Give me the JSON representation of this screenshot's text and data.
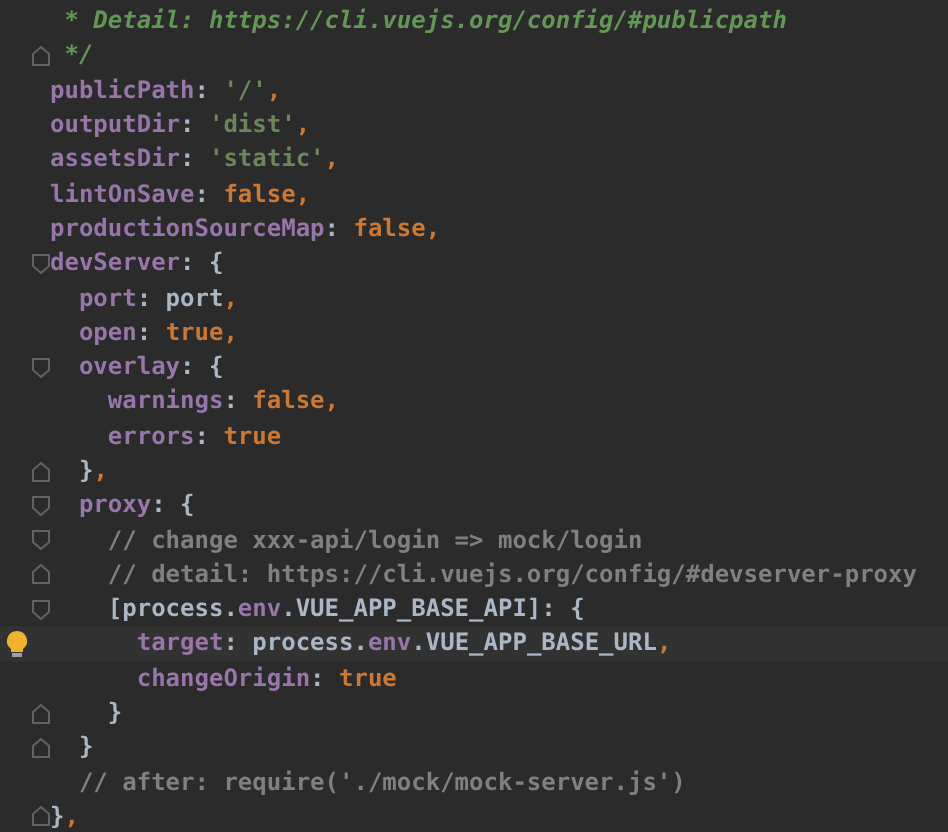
{
  "editor": {
    "lines": [
      {
        "kind": "line",
        "tokens": [
          {
            "t": " * Detail: https://cli.vuejs.org/config/#publicpath",
            "kind": "doc"
          }
        ]
      },
      {
        "kind": "end",
        "tokens": [
          {
            "t": " */",
            "kind": "doc"
          }
        ]
      },
      {
        "kind": "line",
        "tokens": [
          {
            "t": "publicPath",
            "kind": "key"
          },
          {
            "t": ": ",
            "kind": "plain"
          },
          {
            "t": "'/'",
            "kind": "string"
          },
          {
            "t": ",",
            "kind": "punct"
          }
        ]
      },
      {
        "kind": "line",
        "tokens": [
          {
            "t": "outputDir",
            "kind": "key"
          },
          {
            "t": ": ",
            "kind": "plain"
          },
          {
            "t": "'dist'",
            "kind": "string"
          },
          {
            "t": ",",
            "kind": "punct"
          }
        ]
      },
      {
        "kind": "line",
        "tokens": [
          {
            "t": "assetsDir",
            "kind": "key"
          },
          {
            "t": ": ",
            "kind": "plain"
          },
          {
            "t": "'static'",
            "kind": "string"
          },
          {
            "t": ",",
            "kind": "punct"
          }
        ]
      },
      {
        "kind": "line",
        "tokens": [
          {
            "t": "lintOnSave",
            "kind": "key"
          },
          {
            "t": ": ",
            "kind": "plain"
          },
          {
            "t": "false",
            "kind": "keyword"
          },
          {
            "t": ",",
            "kind": "punct"
          }
        ]
      },
      {
        "kind": "line",
        "tokens": [
          {
            "t": "productionSourceMap",
            "kind": "key"
          },
          {
            "t": ": ",
            "kind": "plain"
          },
          {
            "t": "false",
            "kind": "keyword"
          },
          {
            "t": ",",
            "kind": "punct"
          }
        ]
      },
      {
        "kind": "start",
        "tokens": [
          {
            "t": "devServer",
            "kind": "key"
          },
          {
            "t": ": {",
            "kind": "plain"
          }
        ]
      },
      {
        "kind": "line",
        "tokens": [
          {
            "t": "  port",
            "kind": "key"
          },
          {
            "t": ": port",
            "kind": "plain"
          },
          {
            "t": ",",
            "kind": "punct"
          }
        ]
      },
      {
        "kind": "line",
        "tokens": [
          {
            "t": "  open",
            "kind": "key"
          },
          {
            "t": ": ",
            "kind": "plain"
          },
          {
            "t": "true",
            "kind": "keyword"
          },
          {
            "t": ",",
            "kind": "punct"
          }
        ]
      },
      {
        "kind": "start",
        "tokens": [
          {
            "t": "  overlay",
            "kind": "key"
          },
          {
            "t": ": {",
            "kind": "plain"
          }
        ]
      },
      {
        "kind": "line",
        "tokens": [
          {
            "t": "    warnings",
            "kind": "key"
          },
          {
            "t": ": ",
            "kind": "plain"
          },
          {
            "t": "false",
            "kind": "keyword"
          },
          {
            "t": ",",
            "kind": "punct"
          }
        ]
      },
      {
        "kind": "line",
        "tokens": [
          {
            "t": "    errors",
            "kind": "key"
          },
          {
            "t": ": ",
            "kind": "plain"
          },
          {
            "t": "true",
            "kind": "keyword"
          }
        ]
      },
      {
        "kind": "end",
        "tokens": [
          {
            "t": "  }",
            "kind": "plain"
          },
          {
            "t": ",",
            "kind": "punct"
          }
        ]
      },
      {
        "kind": "start",
        "tokens": [
          {
            "t": "  proxy",
            "kind": "key"
          },
          {
            "t": ": {",
            "kind": "plain"
          }
        ]
      },
      {
        "kind": "start",
        "tokens": [
          {
            "t": "    // change xxx-api/login => mock/login",
            "kind": "comment"
          }
        ]
      },
      {
        "kind": "end",
        "tokens": [
          {
            "t": "    // detail: https://cli.vuejs.org/config/#devserver-proxy",
            "kind": "comment"
          }
        ]
      },
      {
        "kind": "start",
        "tokens": [
          {
            "t": "    [process.",
            "kind": "plain"
          },
          {
            "t": "env",
            "kind": "key"
          },
          {
            "t": ".VUE_APP_BASE_API]: {",
            "kind": "plain"
          }
        ]
      },
      {
        "kind": "line",
        "current": true,
        "hint": true,
        "tokens": [
          {
            "t": "      target",
            "kind": "key"
          },
          {
            "t": ": process.",
            "kind": "plain"
          },
          {
            "t": "env",
            "kind": "key"
          },
          {
            "t": ".VUE_APP_BASE_URL",
            "kind": "plain"
          },
          {
            "t": ",",
            "kind": "punct"
          }
        ]
      },
      {
        "kind": "line",
        "tokens": [
          {
            "t": "      changeOrigin",
            "kind": "key"
          },
          {
            "t": ": ",
            "kind": "plain"
          },
          {
            "t": "true",
            "kind": "keyword"
          }
        ]
      },
      {
        "kind": "end",
        "tokens": [
          {
            "t": "    }",
            "kind": "plain"
          }
        ]
      },
      {
        "kind": "end",
        "tokens": [
          {
            "t": "  }",
            "kind": "plain"
          }
        ]
      },
      {
        "kind": "line",
        "tokens": [
          {
            "t": "  // after: require('./mock/mock-server.js')",
            "kind": "comment"
          }
        ]
      },
      {
        "kind": "end",
        "tokens": [
          {
            "t": "}",
            "kind": "plain"
          },
          {
            "t": ",",
            "kind": "punct"
          }
        ]
      }
    ]
  }
}
